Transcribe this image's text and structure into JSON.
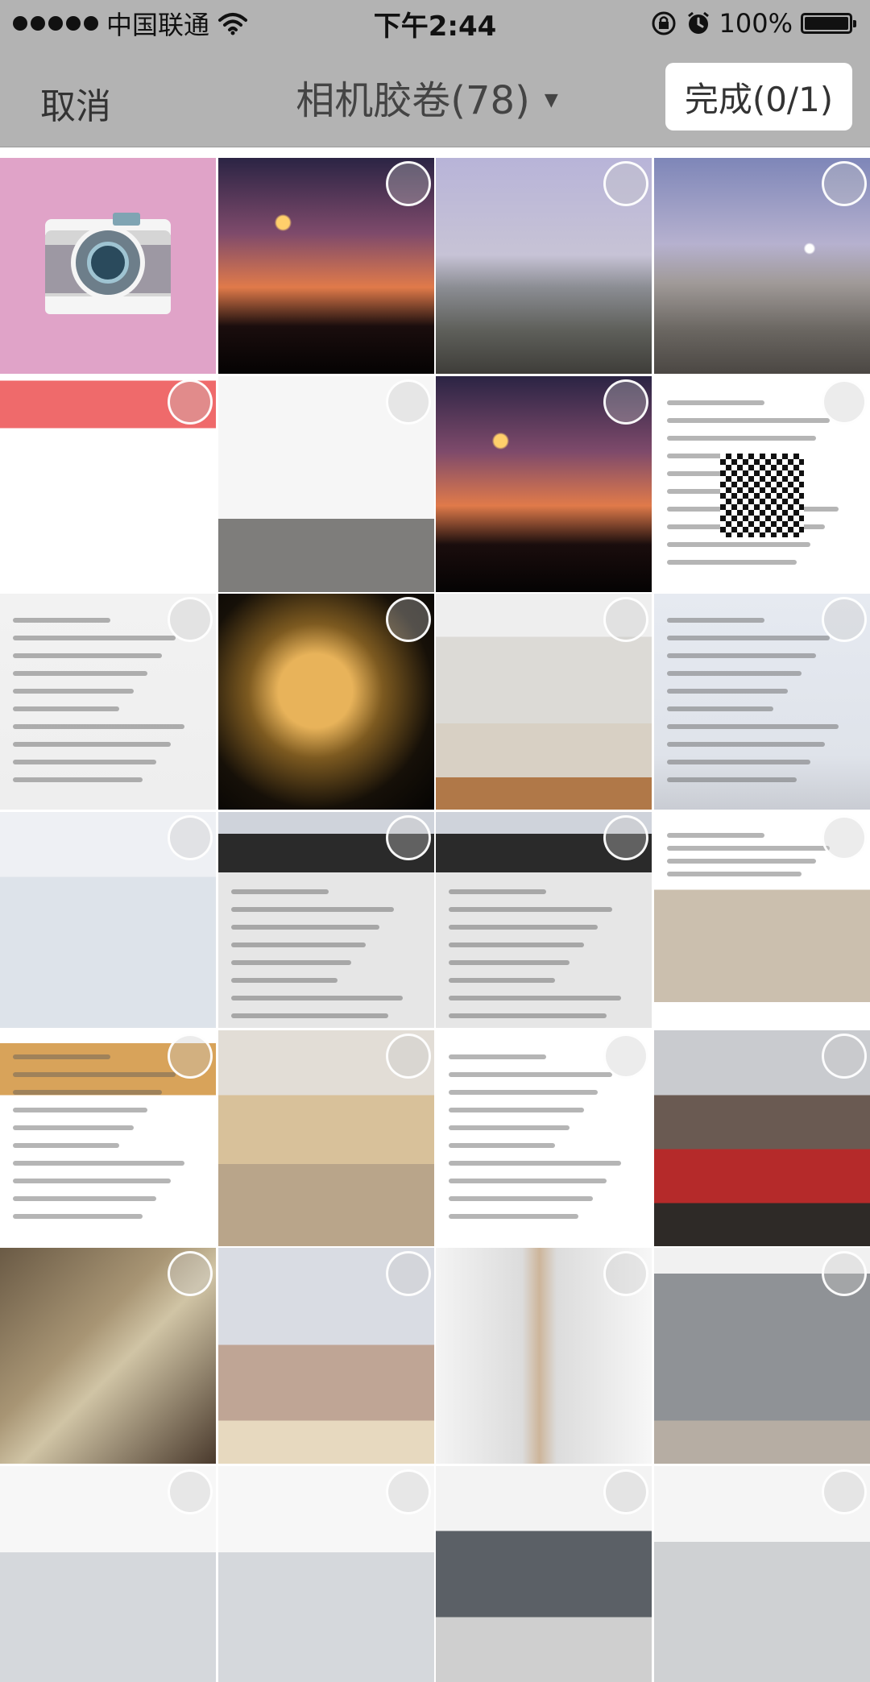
{
  "status_bar": {
    "carrier": "中国联通",
    "time": "下午2:44",
    "battery": "100%",
    "icons": [
      "signal-dots-icon",
      "wifi-icon",
      "rotation-lock-icon",
      "alarm-icon",
      "battery-icon"
    ]
  },
  "nav": {
    "cancel_label": "取消",
    "album_title": "相机胶卷(78)",
    "dropdown_caret": "▼",
    "done_label": "完成(0/1)"
  },
  "grid": {
    "columns": 4,
    "photos": [
      {
        "kind": "camera",
        "selectable": false
      },
      {
        "kind": "sunset-silhouette",
        "selectable": true
      },
      {
        "kind": "city-haze",
        "selectable": true
      },
      {
        "kind": "city-moon",
        "selectable": true
      },
      {
        "kind": "pink-banner-screenshot",
        "selectable": true
      },
      {
        "kind": "profile-screenshot",
        "selectable": true
      },
      {
        "kind": "sunset-silhouette",
        "selectable": true
      },
      {
        "kind": "qr-screenshot",
        "selectable": true
      },
      {
        "kind": "message-screenshot",
        "selectable": true
      },
      {
        "kind": "night-clouds",
        "selectable": true
      },
      {
        "kind": "clothes-rack",
        "selectable": true
      },
      {
        "kind": "form-document",
        "selectable": true
      },
      {
        "kind": "report-chart",
        "selectable": true
      },
      {
        "kind": "ultrasound-report",
        "selectable": true
      },
      {
        "kind": "ultrasound-report",
        "selectable": true
      },
      {
        "kind": "bed-review",
        "selectable": true
      },
      {
        "kind": "shop-screenshot",
        "selectable": true
      },
      {
        "kind": "bed-photo",
        "selectable": true
      },
      {
        "kind": "movie-list",
        "selectable": true
      },
      {
        "kind": "room-red-sofa",
        "selectable": true
      },
      {
        "kind": "old-room",
        "selectable": true
      },
      {
        "kind": "railway-station",
        "selectable": true
      },
      {
        "kind": "white-corridor",
        "selectable": true
      },
      {
        "kind": "grey-wall-room",
        "selectable": true
      },
      {
        "kind": "white-room",
        "selectable": true
      },
      {
        "kind": "white-room",
        "selectable": true
      },
      {
        "kind": "window-room",
        "selectable": true
      },
      {
        "kind": "ceiling-lights",
        "selectable": true
      }
    ]
  }
}
